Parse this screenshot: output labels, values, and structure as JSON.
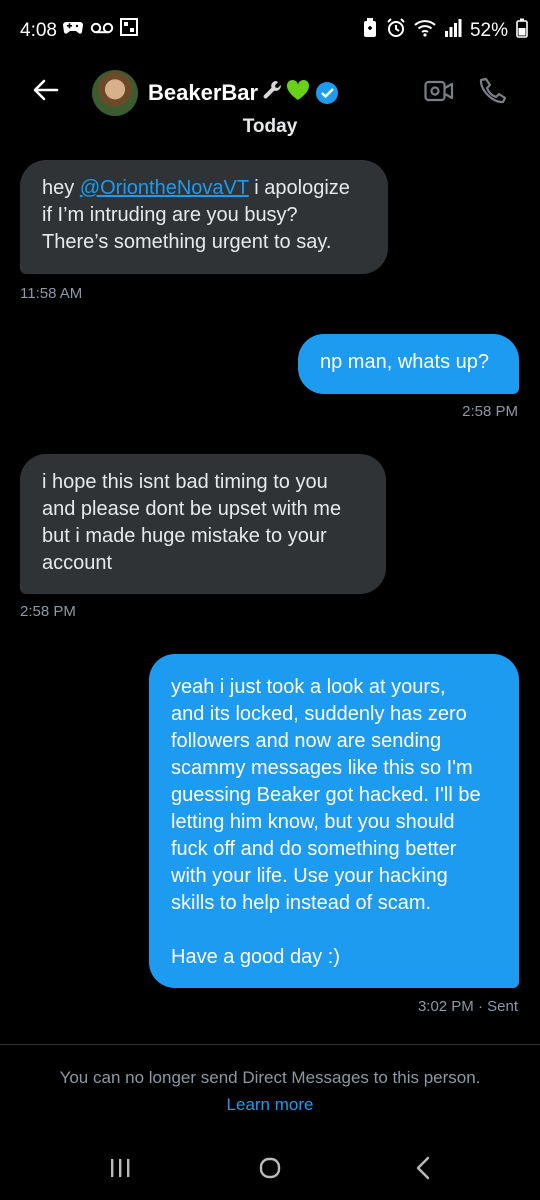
{
  "status": {
    "time": "4:08",
    "battery": "52%",
    "icons": [
      "gamepad-icon",
      "voicemail-icon",
      "gallery-icon",
      "battery-saver-icon",
      "alarm-icon",
      "wifi-icon",
      "signal-icon",
      "battery-icon"
    ]
  },
  "header": {
    "name": "BeakerBar",
    "name_emojis": [
      "wrench-icon",
      "green-heart-icon"
    ],
    "verified": true,
    "icons": [
      "back-arrow-icon",
      "video-call-icon",
      "phone-call-icon"
    ]
  },
  "conversation": {
    "day_divider": "Today",
    "messages": [
      {
        "direction": "in",
        "mention": "@OriontheNovaVT",
        "line1_prefix": "hey ",
        "line1_suffix": " i apologize",
        "line2": "if I’m intruding are you busy?",
        "line3": "There’s something urgent to say.",
        "timestamp": "11:58 AM"
      },
      {
        "direction": "out",
        "text": "np man, whats up?",
        "timestamp": "2:58 PM"
      },
      {
        "direction": "in",
        "lines": [
          "i hope this isnt bad timing to you",
          "and please dont be upset with me",
          "but i made huge mistake to your",
          "account"
        ],
        "timestamp": "2:58 PM"
      },
      {
        "direction": "out",
        "lines": [
          "yeah i just took a look at yours,",
          "and its locked, suddenly has zero",
          "followers and now are sending",
          "scammy messages like this so I'm",
          "guessing Beaker got hacked. I'll be",
          "letting him know, but you should",
          "fuck off and do something better",
          "with your life. Use your hacking",
          "skills to help instead of scam.",
          "",
          "Have a good day :)"
        ],
        "timestamp": "3:02 PM · Sent"
      }
    ]
  },
  "footer": {
    "notice": "You can no longer send Direct Messages to this person.",
    "learn_more": "Learn more"
  },
  "navbar": {
    "icons": [
      "recent-apps-icon",
      "home-icon",
      "back-icon"
    ]
  },
  "colors": {
    "background": "#000000",
    "incoming_bubble": "#2f3336",
    "outgoing_bubble": "#1d9bf0",
    "link": "#1d9bf0",
    "muted_text": "#8b98a5"
  }
}
